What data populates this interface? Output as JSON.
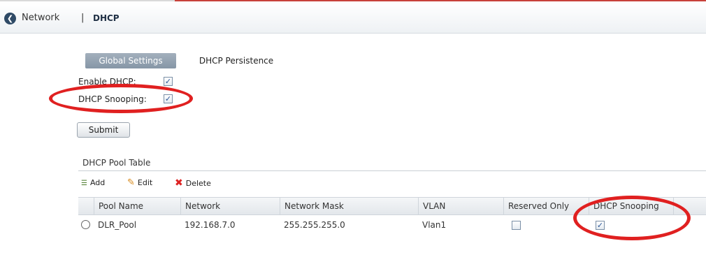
{
  "breadcrumb": {
    "parent": "Network",
    "separator": "|",
    "current": "DHCP"
  },
  "tabs": [
    {
      "label": "Global Settings",
      "active": true
    },
    {
      "label": "DHCP Persistence",
      "active": false
    }
  ],
  "global_settings": {
    "enable_dhcp_label": "Enable DHCP:",
    "enable_dhcp_checked": true,
    "dhcp_snooping_label": "DHCP Snooping:",
    "dhcp_snooping_checked": true,
    "submit_label": "Submit"
  },
  "pool_table": {
    "title": "DHCP Pool Table",
    "toolbar": {
      "add_label": "Add",
      "edit_label": "Edit",
      "delete_label": "Delete"
    },
    "columns": [
      "Pool Name",
      "Network",
      "Network Mask",
      "VLAN",
      "Reserved Only",
      "DHCP Snooping"
    ],
    "rows": [
      {
        "pool_name": "DLR_Pool",
        "network": "192.168.7.0",
        "network_mask": "255.255.255.0",
        "vlan": "Vlan1",
        "reserved_only": false,
        "dhcp_snooping": true
      }
    ]
  },
  "colors": {
    "annotation": "#e02020",
    "active_tab": "#8c9cac",
    "accent_line": "#c8413a"
  }
}
